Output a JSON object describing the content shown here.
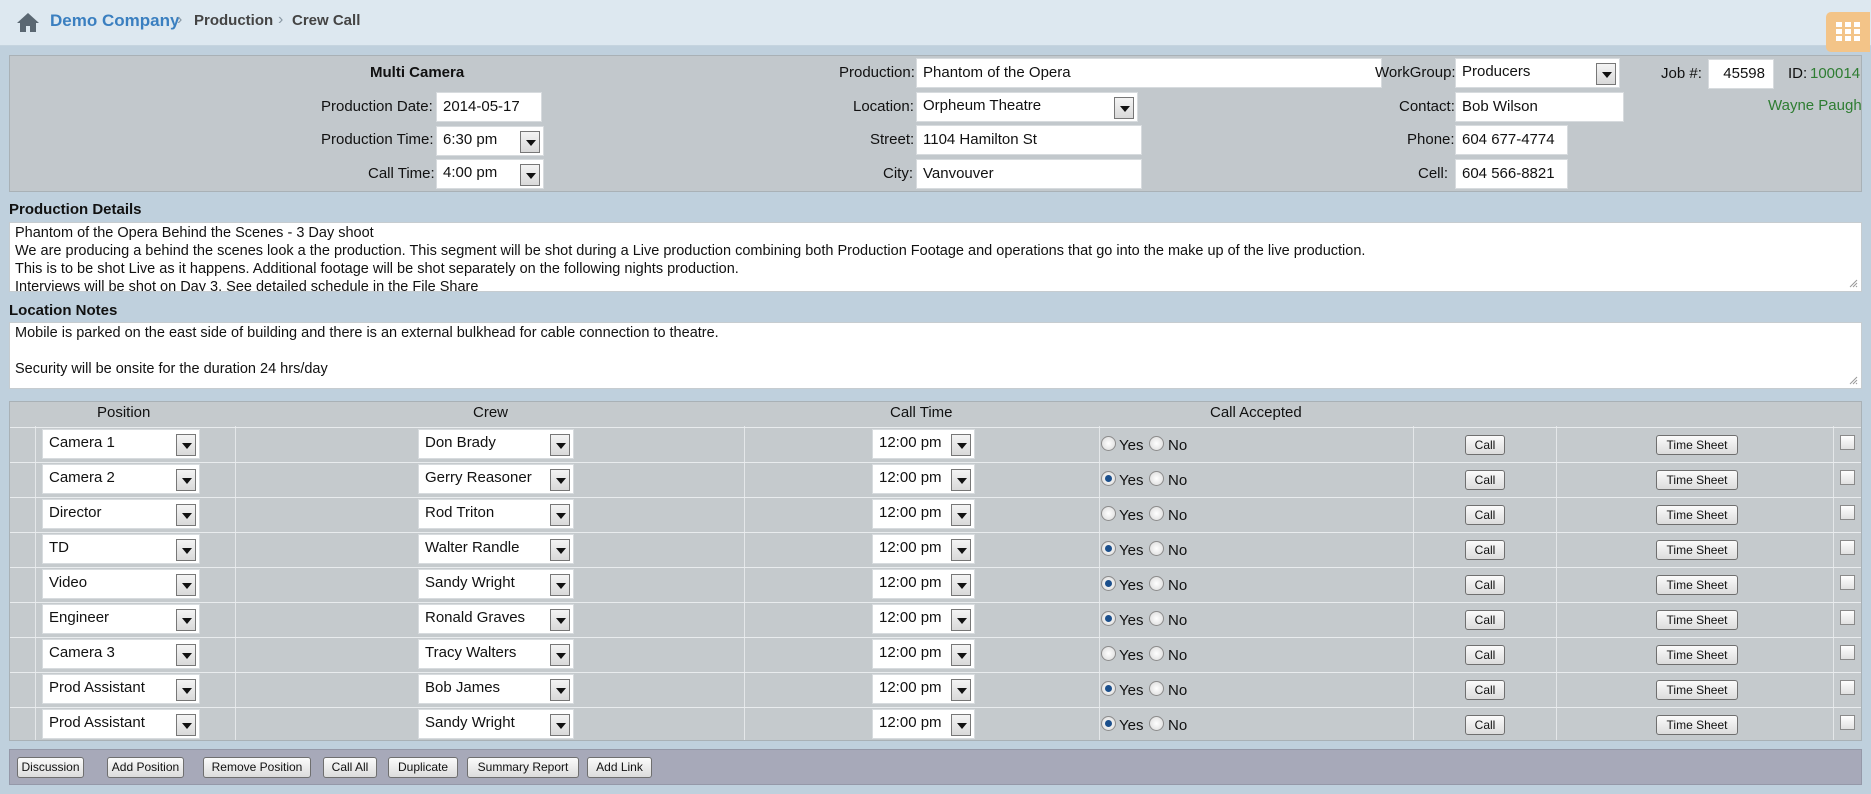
{
  "breadcrumb": {
    "company": "Demo Company",
    "production": "Production",
    "page": "Crew Call",
    "sep": "›"
  },
  "header": {
    "type_label": "Multi Camera",
    "production_date_label": "Production Date:",
    "production_date": "2014-05-17",
    "production_time_label": "Production Time:",
    "production_time": "6:30 pm",
    "call_time_label": "Call Time:",
    "call_time": "4:00 pm",
    "production_label": "Production:",
    "production": "Phantom of the Opera",
    "location_label": "Location:",
    "location": "Orpheum Theatre",
    "street_label": "Street:",
    "street": "1104 Hamilton St",
    "city_label": "City:",
    "city": "Vanvouver",
    "workgroup_label": "WorkGroup:",
    "workgroup": "Producers",
    "contact_label": "Contact:",
    "contact": "Bob Wilson",
    "phone_label": "Phone:",
    "phone": "604 677-4774",
    "cell_label": "Cell:",
    "cell": "604 566-8821",
    "job_label": "Job #:",
    "job": "45598",
    "id_label": "ID:",
    "id": "100014",
    "user": "Wayne Paugh"
  },
  "production_details": {
    "title": "Production Details",
    "lines": [
      "Phantom of the Opera Behind the Scenes - 3 Day shoot",
      "We are producing a behind the scenes look a the production. This segment will be shot during a Live production combining both Production Footage and operations that go into the make up of the live production.",
      "This is to be shot Live as it happens. Additional footage will be shot separately on the following nights production.",
      "Interviews will be shot on Day 3. See detailed schedule in the File Share"
    ]
  },
  "location_notes": {
    "title": "Location Notes",
    "lines": [
      "Mobile is parked on the east side of building and there is an external bulkhead for cable connection to theatre.",
      "",
      "Security will be onsite for the duration 24 hrs/day"
    ]
  },
  "crew_table": {
    "headers": {
      "position": "Position",
      "crew": "Crew",
      "call_time": "Call Time",
      "call_accepted": "Call Accepted"
    },
    "yes_label": "Yes",
    "no_label": "No",
    "call_label": "Call",
    "timesheet_label": "Time Sheet",
    "rows": [
      {
        "position": "Camera 1",
        "crew": "Don Brady",
        "time": "12:00 pm",
        "accepted": "none"
      },
      {
        "position": "Camera 2",
        "crew": "Gerry Reasoner",
        "time": "12:00 pm",
        "accepted": "yes"
      },
      {
        "position": "Director",
        "crew": "Rod Triton",
        "time": "12:00 pm",
        "accepted": "none"
      },
      {
        "position": "TD",
        "crew": "Walter Randle",
        "time": "12:00 pm",
        "accepted": "yes"
      },
      {
        "position": "Video",
        "crew": "Sandy Wright",
        "time": "12:00 pm",
        "accepted": "yes"
      },
      {
        "position": "Engineer",
        "crew": "Ronald Graves",
        "time": "12:00 pm",
        "accepted": "yes"
      },
      {
        "position": "Camera 3",
        "crew": "Tracy Walters",
        "time": "12:00 pm",
        "accepted": "none"
      },
      {
        "position": "Prod Assistant",
        "crew": "Bob James",
        "time": "12:00 pm",
        "accepted": "yes"
      },
      {
        "position": "Prod Assistant",
        "crew": "Sandy Wright",
        "time": "12:00 pm",
        "accepted": "yes"
      }
    ]
  },
  "footer_buttons": [
    "Discussion",
    "Add Position",
    "Remove Position",
    "Call All",
    "Duplicate",
    "Summary Report",
    "Add Link"
  ],
  "colors": {
    "link": "#3a7fc0",
    "user": "#2e7d32",
    "selected_radio": "#1b4f8c",
    "grid_button": "#f3c488"
  }
}
